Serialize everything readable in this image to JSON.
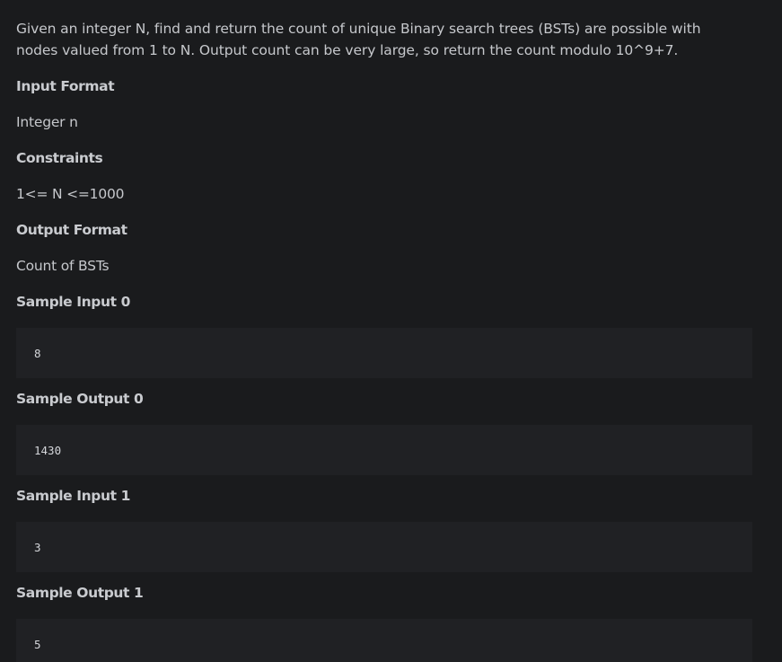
{
  "problem": {
    "description": "Given an integer N, find and return the count of unique Binary search trees (BSTs) are possible with nodes valued from 1 to N. Output count can be very large, so return the count modulo 10^9+7.",
    "input_format_heading": "Input Format",
    "input_format_text": "Integer n",
    "constraints_heading": "Constraints",
    "constraints_text": "1<= N <=1000",
    "output_format_heading": "Output Format",
    "output_format_text": "Count of BSTs",
    "samples": [
      {
        "input_heading": "Sample Input 0",
        "input_value": "8",
        "output_heading": "Sample Output 0",
        "output_value": "1430"
      },
      {
        "input_heading": "Sample Input 1",
        "input_value": "3",
        "output_heading": "Sample Output 1",
        "output_value": "5"
      }
    ]
  }
}
